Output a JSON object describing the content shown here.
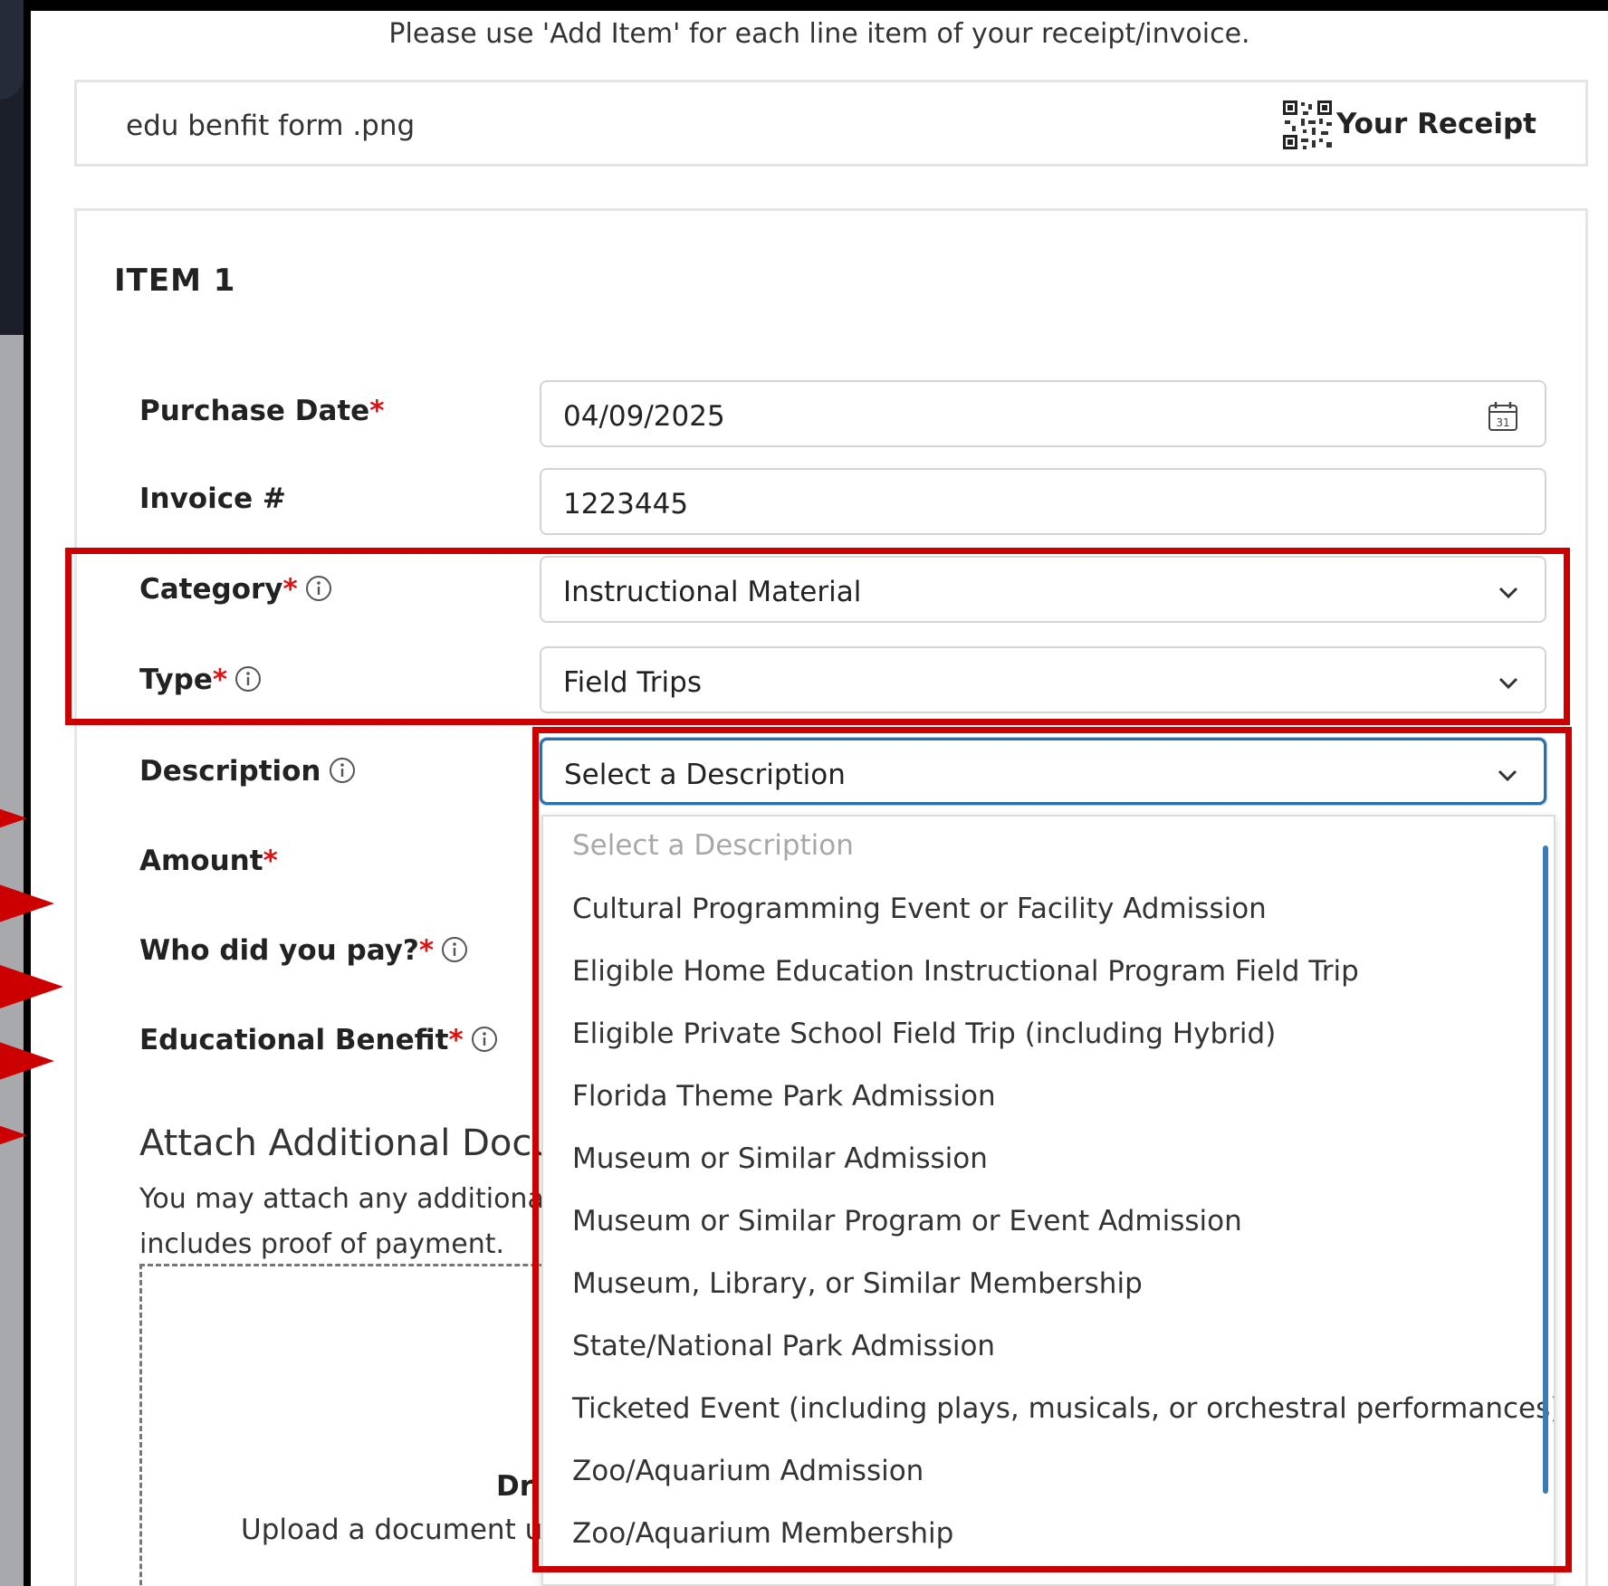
{
  "instruction": "Please use 'Add Item' for each line item of your receipt/invoice.",
  "receipt": {
    "file_name": "edu benfit form .png",
    "qr_icon": "qr-code-icon",
    "label": "Your Receipt"
  },
  "item": {
    "title": "ITEM 1",
    "required_marker": "*",
    "fields": {
      "purchase_date": {
        "label": "Purchase Date",
        "value": "04/09/2025",
        "icon": "calendar-icon",
        "icon_text": "31"
      },
      "invoice": {
        "label": "Invoice #",
        "value": "1223445"
      },
      "category": {
        "label": "Category",
        "value": "Instructional Material"
      },
      "type": {
        "label": "Type",
        "value": "Field Trips"
      },
      "description": {
        "label": "Description",
        "value": "Select a Description"
      },
      "amount": {
        "label": "Amount"
      },
      "who_paid": {
        "label": "Who did you pay?"
      },
      "educational_benefit": {
        "label": "Educational Benefit"
      }
    }
  },
  "description_dropdown": {
    "placeholder": "Select a Description",
    "options": [
      "Cultural Programming Event or Facility Admission",
      "Eligible Home Education Instructional Program Field Trip",
      "Eligible Private School Field Trip (including Hybrid)",
      "Florida Theme Park Admission",
      "Museum or Similar Admission",
      "Museum or Similar Program or Event Admission",
      "Museum, Library, or Similar Membership",
      "State/National Park Admission",
      "Ticketed Event (including plays, musicals, or orchestral performances)",
      "Zoo/Aquarium Admission",
      "Zoo/Aquarium Membership"
    ]
  },
  "attach": {
    "title": "Attach Additional Docu",
    "text_line1": "You may attach any additiona",
    "text_line2": "includes proof of payment.",
    "drop_title": "Dr",
    "drop_text": "Upload a document u"
  },
  "colors": {
    "highlight": "#cc0000",
    "focus_border": "#2a6fa8",
    "required": "#dd1111"
  }
}
